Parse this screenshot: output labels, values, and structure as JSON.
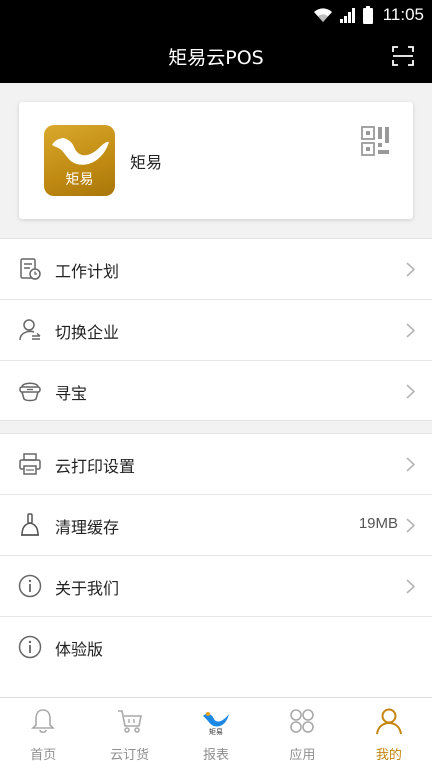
{
  "status_bar": {
    "time": "11:05"
  },
  "app_bar": {
    "title": "矩易云POS"
  },
  "profile": {
    "logo_text": "矩易",
    "company_name": "矩易"
  },
  "menu_group_1": [
    {
      "label": "工作计划",
      "icon": "work-plan-icon"
    },
    {
      "label": "切换企业",
      "icon": "switch-company-icon"
    },
    {
      "label": "寻宝",
      "icon": "treasure-icon"
    }
  ],
  "menu_group_2": [
    {
      "label": "云打印设置",
      "icon": "printer-icon",
      "value": ""
    },
    {
      "label": "清理缓存",
      "icon": "broom-icon",
      "value": "19MB"
    },
    {
      "label": "关于我们",
      "icon": "info-icon",
      "value": ""
    },
    {
      "label": "体验版",
      "icon": "info-icon",
      "value": ""
    }
  ],
  "tabs": [
    {
      "label": "首页",
      "icon": "bell-icon",
      "active": false
    },
    {
      "label": "云订货",
      "icon": "cart-icon",
      "active": false
    },
    {
      "label": "报表",
      "icon": "report-logo-icon",
      "active": false
    },
    {
      "label": "应用",
      "icon": "apps-icon",
      "active": false
    },
    {
      "label": "我的",
      "icon": "person-icon",
      "active": true
    }
  ],
  "colors": {
    "accent": "#c5850f",
    "header_bg": "#000000",
    "logo_gold": "#c99a1f"
  }
}
